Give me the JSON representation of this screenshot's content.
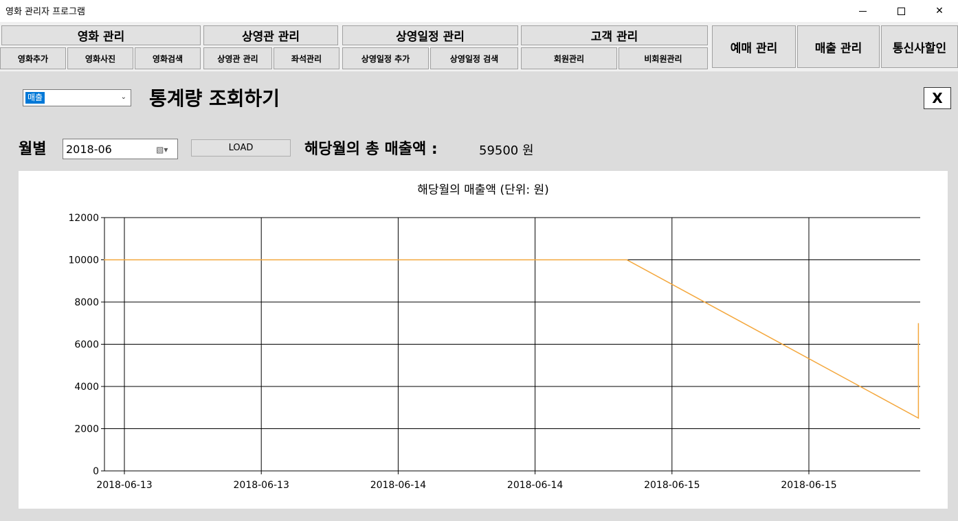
{
  "window": {
    "title": "영화 관리자 프로그램",
    "controls": {
      "minimize": "—",
      "maximize": "☐",
      "close": "✕"
    }
  },
  "menu": {
    "groups": [
      {
        "label": "영화 관리",
        "items": [
          "영화추가",
          "영화사진",
          "영화검색"
        ]
      },
      {
        "label": "상영관 관리",
        "items": [
          "상영관 관리",
          "좌석관리"
        ]
      },
      {
        "label": "상영일정 관리",
        "items": [
          "상영일정 추가",
          "상영일정 검색"
        ]
      },
      {
        "label": "고객 관리",
        "items": [
          "회원관리",
          "비회원관리"
        ]
      }
    ],
    "buttons": [
      "예매 관리",
      "매출 관리",
      "통신사할인"
    ]
  },
  "stats": {
    "combo_value": "매출",
    "heading": "통계량 조회하기",
    "close_label": "X",
    "month_label": "월별",
    "date_value": "2018-06",
    "load_label": "LOAD",
    "total_label": "해당월의 총 매출액 :",
    "total_value": "59500 원"
  },
  "chart_data": {
    "type": "line",
    "title": "해당월의 매출액 (단위: 원)",
    "xlabel": "",
    "ylabel": "",
    "ylim": [
      0,
      12000
    ],
    "yticks": [
      0,
      2000,
      4000,
      6000,
      8000,
      10000,
      12000
    ],
    "xlim": [
      0,
      6
    ],
    "xticks": [
      {
        "x": 0,
        "label": "2018-06-13"
      },
      {
        "x": 1,
        "label": "2018-06-13"
      },
      {
        "x": 2,
        "label": "2018-06-14"
      },
      {
        "x": 3,
        "label": "2018-06-14"
      },
      {
        "x": 4,
        "label": "2018-06-15"
      },
      {
        "x": 5,
        "label": "2018-06-15"
      }
    ],
    "grid": true,
    "series": [
      {
        "color": "#f4a73c",
        "points": [
          {
            "x": -0.15,
            "y": 10000
          },
          {
            "x": 3.67,
            "y": 10000
          },
          {
            "x": 5.8,
            "y": 2500
          },
          {
            "x": 5.8,
            "y": 7000
          }
        ]
      }
    ]
  }
}
